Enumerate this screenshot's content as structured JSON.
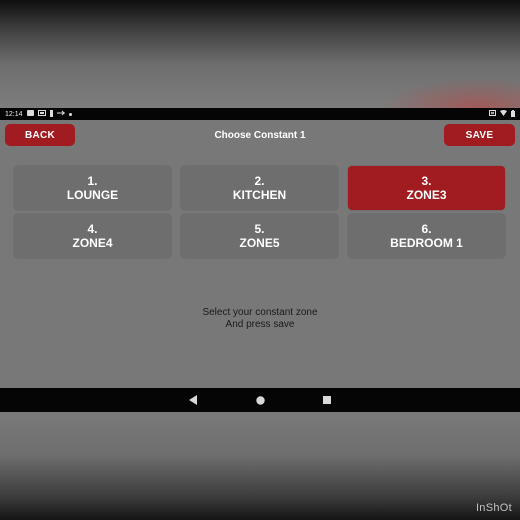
{
  "status_bar": {
    "time": "12:14",
    "icons_left": [
      "notification-icon",
      "gallery-icon",
      "battery-saver-icon",
      "usb-icon",
      "dot-icon"
    ],
    "icons_right": [
      "sim-icon",
      "wifi-icon",
      "battery-icon"
    ]
  },
  "header": {
    "back_label": "BACK",
    "title": "Choose Constant 1",
    "save_label": "SAVE"
  },
  "zones": [
    {
      "number": "1.",
      "name": "LOUNGE",
      "selected": false
    },
    {
      "number": "2.",
      "name": "KITCHEN",
      "selected": false
    },
    {
      "number": "3.",
      "name": "ZONE3",
      "selected": true
    },
    {
      "number": "4.",
      "name": "ZONE4",
      "selected": false
    },
    {
      "number": "5.",
      "name": "ZONE5",
      "selected": false
    },
    {
      "number": "6.",
      "name": "BEDROOM 1",
      "selected": false
    }
  ],
  "instructions": {
    "line1": "Select your constant zone",
    "line2": "And press save"
  },
  "watermark": "InShOt",
  "colors": {
    "accent": "#a01c20",
    "tile": "#6e6e6e",
    "background": "#787878"
  }
}
